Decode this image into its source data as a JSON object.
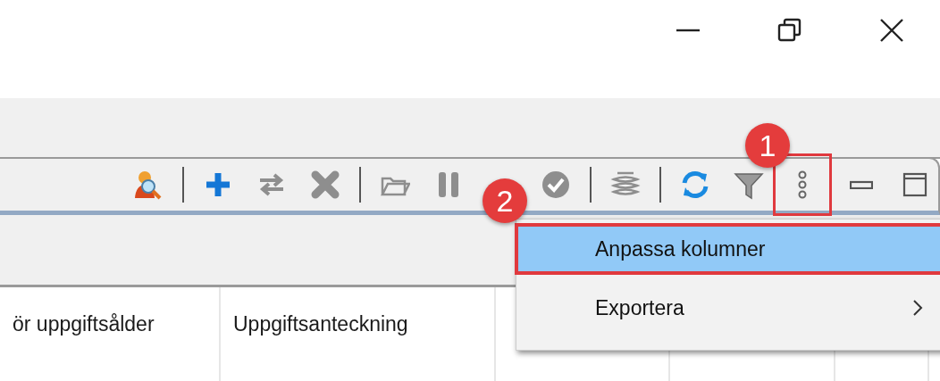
{
  "window_controls": [
    {
      "kind": "minimize"
    },
    {
      "kind": "restore"
    },
    {
      "kind": "close"
    }
  ],
  "toolbar": {
    "groups": [
      [
        {
          "kind": "user-search",
          "disabled": false
        }
      ],
      [
        {
          "kind": "add",
          "disabled": false
        },
        {
          "kind": "swap",
          "disabled": true
        },
        {
          "kind": "delete",
          "disabled": true
        }
      ],
      [
        {
          "kind": "folder",
          "disabled": true
        },
        {
          "kind": "pause",
          "disabled": true
        },
        {
          "kind": "check",
          "disabled": true
        }
      ],
      [
        {
          "kind": "stack",
          "disabled": true
        }
      ],
      [
        {
          "kind": "refresh",
          "disabled": false
        },
        {
          "kind": "filter",
          "disabled": false
        },
        {
          "kind": "more",
          "disabled": false,
          "highlighted": true
        }
      ]
    ],
    "view_buttons": [
      {
        "kind": "minimize"
      },
      {
        "kind": "maximize"
      }
    ]
  },
  "table": {
    "columns": [
      {
        "label": "ör uppgiftsålder"
      },
      {
        "label": "Uppgiftsanteckning"
      },
      {},
      {},
      {}
    ]
  },
  "context_menu": {
    "items": [
      {
        "label": "Anpassa kolumner",
        "selected": true,
        "kind": "action"
      },
      {
        "label": "Exportera",
        "selected": false,
        "kind": "submenu"
      }
    ]
  },
  "callouts": [
    {
      "label": "1"
    },
    {
      "label": "2"
    }
  ]
}
